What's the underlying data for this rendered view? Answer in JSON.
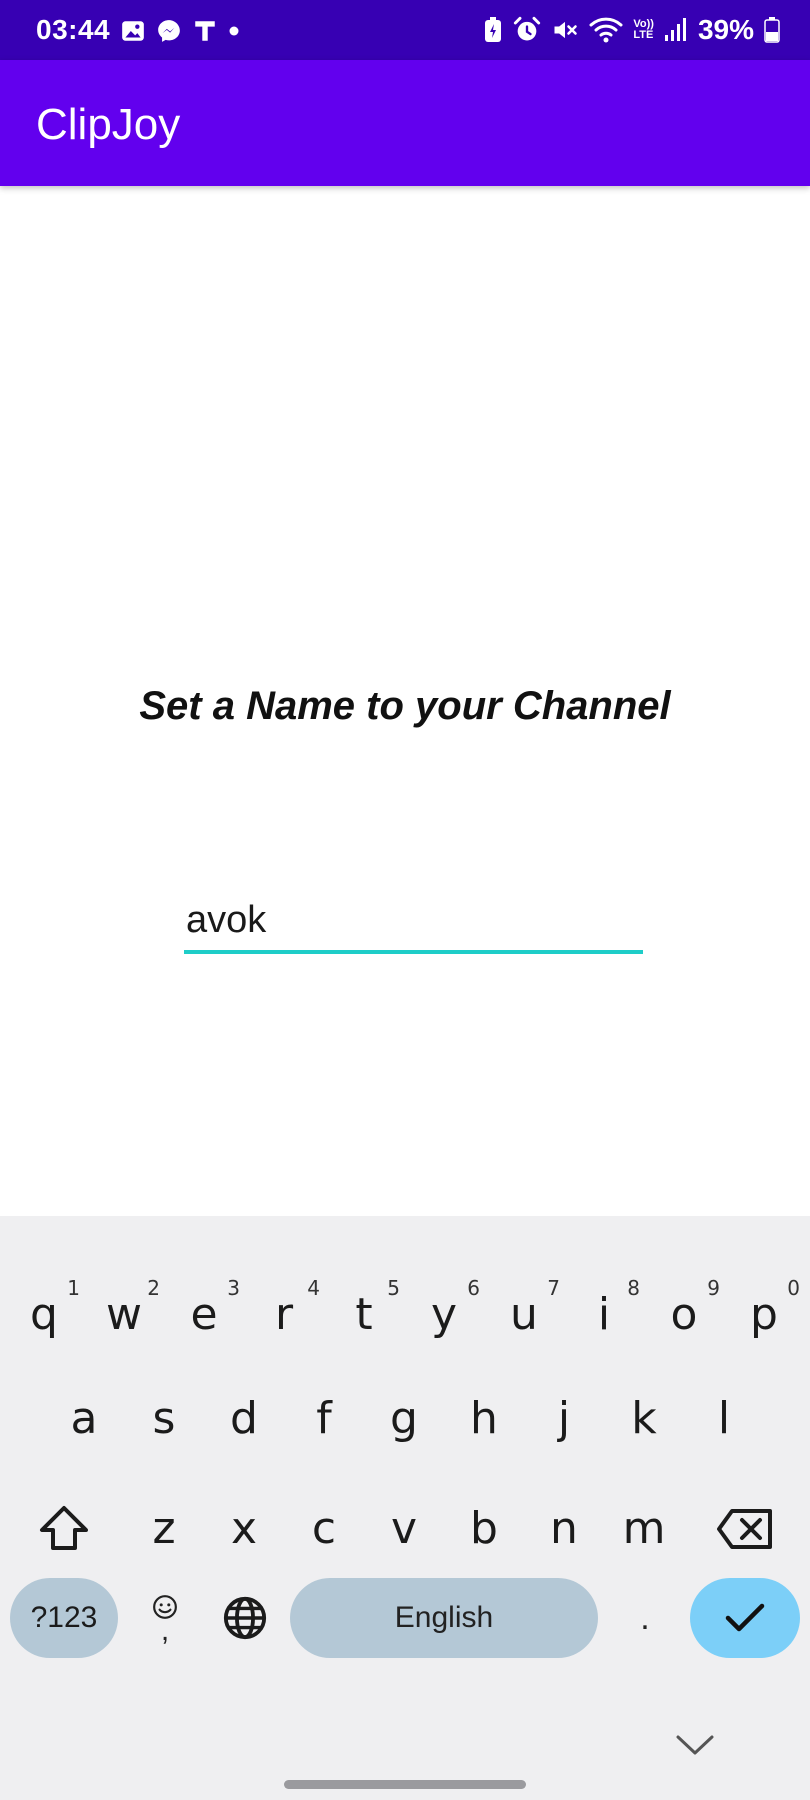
{
  "status_bar": {
    "time": "03:44",
    "battery_percent": "39%",
    "left_icons": [
      "gallery-icon",
      "messenger-icon",
      "t-app-icon",
      "dot-icon"
    ],
    "right_icons": [
      "battery-saver-icon",
      "alarm-icon",
      "mute-icon",
      "wifi-icon",
      "volte-icon",
      "signal-icon",
      "battery-icon"
    ],
    "volte_top": "Vo))",
    "volte_bottom": "LTE"
  },
  "app_bar": {
    "title": "ClipJoy",
    "color": "#6200EE",
    "status_color": "#3700B3"
  },
  "main": {
    "heading": "Set a Name to your Channel",
    "name_input": {
      "value": "avok",
      "placeholder": "",
      "underline_color": "#1ECDC8"
    }
  },
  "keyboard": {
    "row1": [
      {
        "k": "q",
        "s": "1"
      },
      {
        "k": "w",
        "s": "2"
      },
      {
        "k": "e",
        "s": "3"
      },
      {
        "k": "r",
        "s": "4"
      },
      {
        "k": "t",
        "s": "5"
      },
      {
        "k": "y",
        "s": "6"
      },
      {
        "k": "u",
        "s": "7"
      },
      {
        "k": "i",
        "s": "8"
      },
      {
        "k": "o",
        "s": "9"
      },
      {
        "k": "p",
        "s": "0"
      }
    ],
    "row2": [
      "a",
      "s",
      "d",
      "f",
      "g",
      "h",
      "j",
      "k",
      "l"
    ],
    "row3": [
      "z",
      "x",
      "c",
      "v",
      "b",
      "n",
      "m"
    ],
    "symbols_label": "?123",
    "emoji_comma_label": ",",
    "space_label": "English",
    "period_label": ".",
    "enter_icon": "check-icon",
    "shift_icon": "shift-icon",
    "delete_icon": "backspace-icon",
    "globe_icon": "globe-icon",
    "hide_icon": "chevron-down-icon"
  }
}
